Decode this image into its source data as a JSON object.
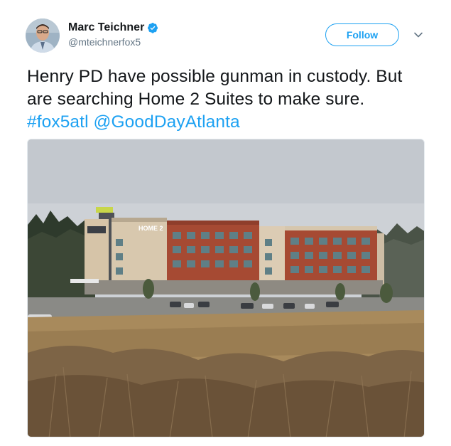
{
  "tweet": {
    "author": {
      "display_name": "Marc Teichner",
      "handle": "@mteichnerfox5",
      "verified": true
    },
    "follow_label": "Follow",
    "text_main": "Henry PD have possible gunman in custody. But are searching Home 2 Suites to make sure.",
    "hashtag": "#fox5atl",
    "mention": "@GoodDayAtlanta",
    "photo_sign": "HOME 2",
    "colors": {
      "link": "#1da1f2",
      "text": "#14171a",
      "secondary": "#657786"
    },
    "icons": [
      "verified-badge-icon",
      "chevron-down-icon"
    ]
  }
}
